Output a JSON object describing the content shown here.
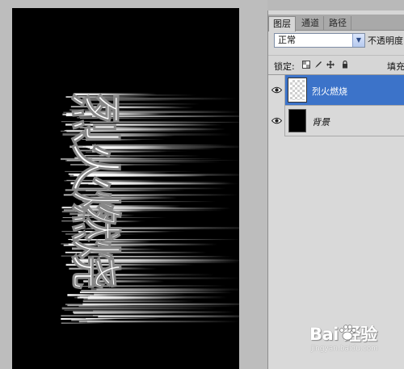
{
  "canvas": {
    "artwork_text": "烈火燃烧"
  },
  "layers_panel": {
    "tabs": [
      {
        "label": "图层",
        "active": true
      },
      {
        "label": "通道",
        "active": false
      },
      {
        "label": "路径",
        "active": false
      }
    ],
    "blend_mode": "正常",
    "opacity_label": "不透明度",
    "lock_label": "锁定:",
    "fill_label": "填充",
    "layers": [
      {
        "name": "烈火燃烧",
        "selected": true,
        "visible": true,
        "thumbnail": "transparent"
      },
      {
        "name": "背景",
        "selected": false,
        "visible": true,
        "thumbnail": "black"
      }
    ]
  },
  "watermark": {
    "main": "Bai 经验",
    "sub": "jingyan.baidu.com"
  },
  "colors": {
    "selection": "#3c73c9",
    "canvas_bg": "#000000",
    "workspace_bg": "#bdbdbd"
  }
}
